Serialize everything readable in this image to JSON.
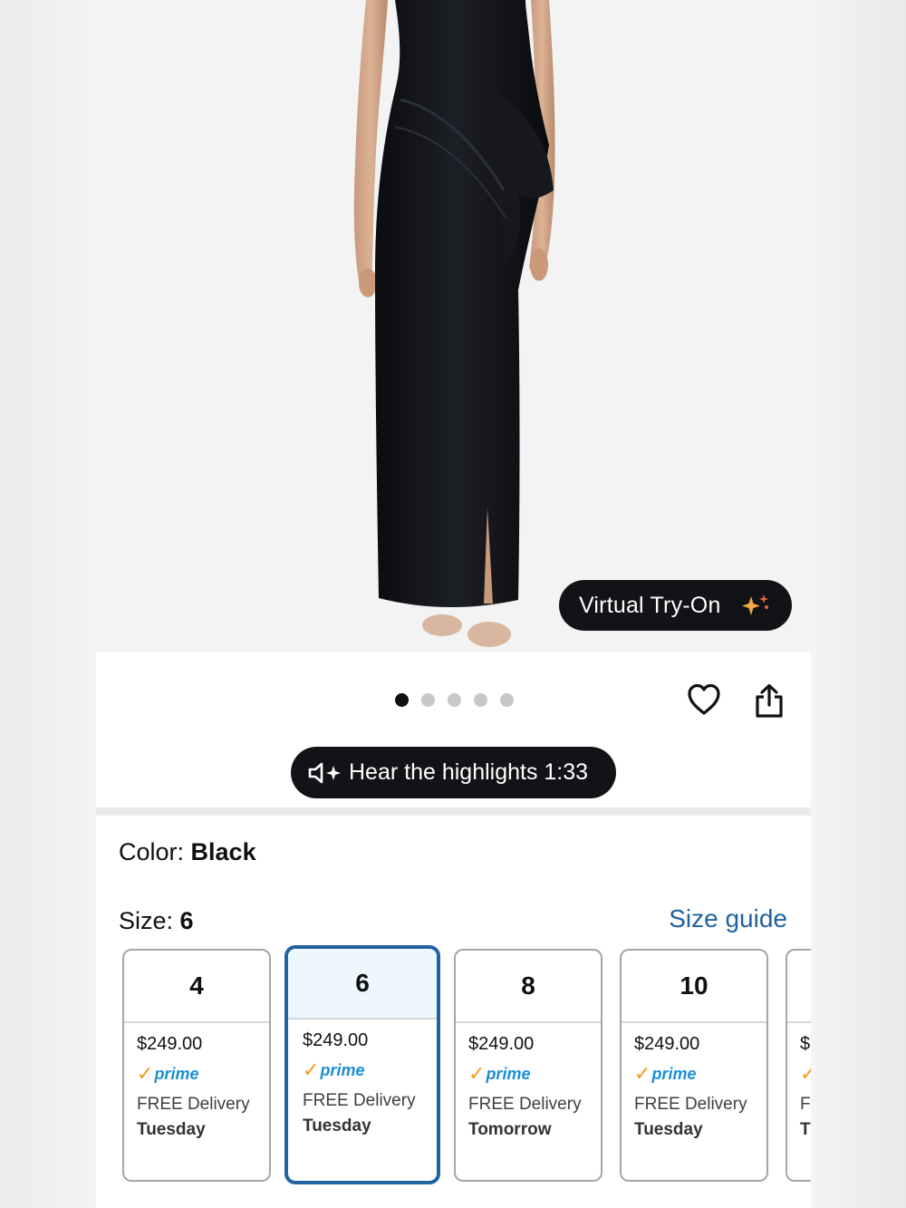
{
  "product": {
    "image_alt": "Black satin one-shoulder column gown with draped ruffle",
    "image_indicators": {
      "count": 5,
      "active_index": 0
    },
    "virtual_try_on_label": "Virtual Try-On",
    "hear_highlights_label": "Hear the highlights 1:33"
  },
  "color": {
    "label": "Color: ",
    "value": "Black"
  },
  "size": {
    "label": "Size: ",
    "value": "6",
    "guide_label": "Size guide",
    "options": [
      {
        "size": "4",
        "price": "$249.00",
        "prime": "prime",
        "delivery": "FREE Delivery",
        "day": "Tuesday",
        "selected": false
      },
      {
        "size": "6",
        "price": "$249.00",
        "prime": "prime",
        "delivery": "FREE Delivery",
        "day": "Tuesday",
        "selected": true
      },
      {
        "size": "8",
        "price": "$249.00",
        "prime": "prime",
        "delivery": "FREE Delivery",
        "day": "Tomorrow",
        "selected": false
      },
      {
        "size": "10",
        "price": "$249.00",
        "prime": "prime",
        "delivery": "FREE Delivery",
        "day": "Tuesday",
        "selected": false
      },
      {
        "size": "",
        "price": "$",
        "prime": "",
        "delivery": "Fl",
        "day": "T",
        "selected": false
      }
    ]
  },
  "colors": {
    "accent_blue": "#2162a1",
    "prime_blue": "#1a8fd6",
    "prime_check": "#f79a1e",
    "pill_bg": "#111316"
  }
}
